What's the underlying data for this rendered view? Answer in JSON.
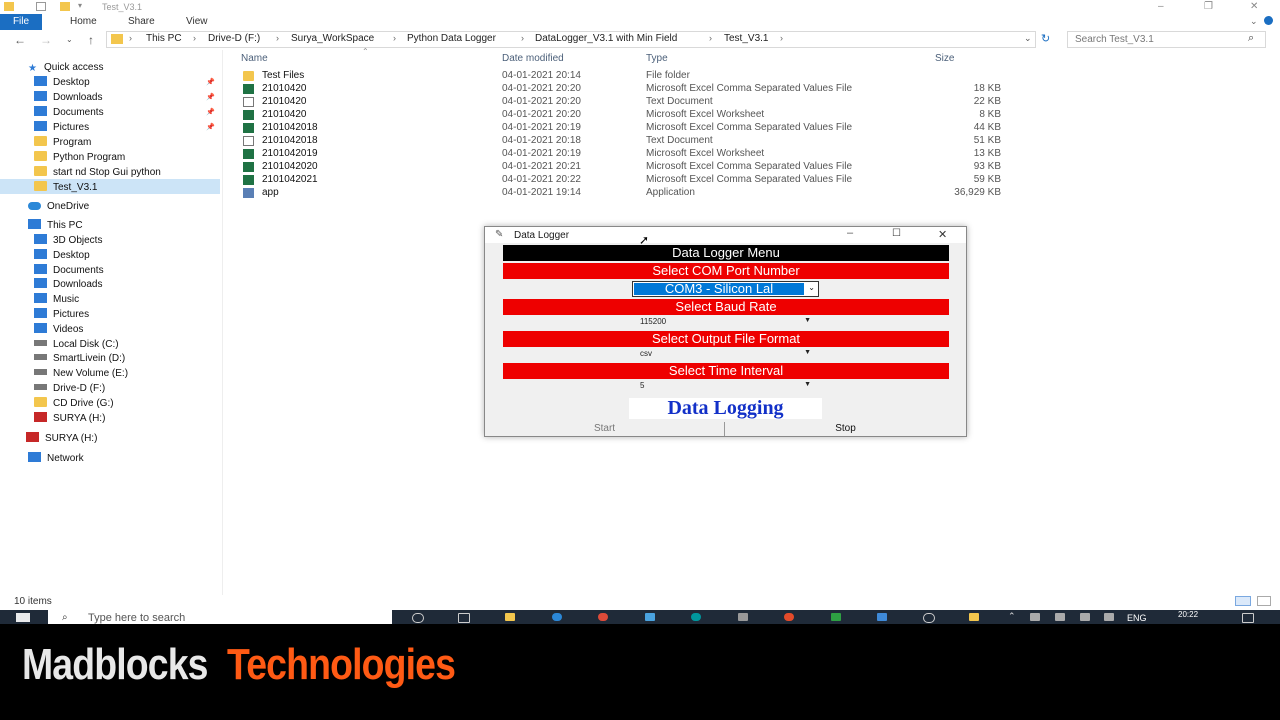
{
  "window": {
    "title": "Test_V3.1"
  },
  "ribbon": {
    "tabs": [
      "File",
      "Home",
      "Share",
      "View"
    ]
  },
  "address": {
    "breadcrumbs": [
      "This PC",
      "Drive-D (F:)",
      "Surya_WorkSpace",
      "Python Data Logger",
      "DataLogger_V3.1 with Min Field",
      "Test_V3.1"
    ],
    "search_placeholder": "Search Test_V3.1"
  },
  "nav_pane": {
    "quick_access": "Quick access",
    "quick_items": [
      "Desktop",
      "Downloads",
      "Documents",
      "Pictures",
      "Program",
      "Python Program",
      "start nd Stop Gui python",
      "Test_V3.1"
    ],
    "onedrive": "OneDrive",
    "this_pc": "This PC",
    "pc_items": [
      "3D Objects",
      "Desktop",
      "Documents",
      "Downloads",
      "Music",
      "Pictures",
      "Videos",
      "Local Disk (C:)",
      "SmartLivein (D:)",
      "New Volume (E:)",
      "Drive-D (F:)",
      "CD Drive (G:)",
      "SURYA (H:)"
    ],
    "surya": "SURYA (H:)",
    "network": "Network"
  },
  "file_list": {
    "headers": [
      "Name",
      "Date modified",
      "Type",
      "Size"
    ],
    "rows": [
      {
        "icon": "folder",
        "name": "Test Files",
        "date": "04-01-2021 20:14",
        "type": "File folder",
        "size": ""
      },
      {
        "icon": "xls",
        "name": "21010420",
        "date": "04-01-2021 20:20",
        "type": "Microsoft Excel Comma Separated Values File",
        "size": "18 KB"
      },
      {
        "icon": "txt",
        "name": "21010420",
        "date": "04-01-2021 20:20",
        "type": "Text Document",
        "size": "22 KB"
      },
      {
        "icon": "xls",
        "name": "21010420",
        "date": "04-01-2021 20:20",
        "type": "Microsoft Excel Worksheet",
        "size": "8 KB"
      },
      {
        "icon": "xls",
        "name": "2101042018",
        "date": "04-01-2021 20:19",
        "type": "Microsoft Excel Comma Separated Values File",
        "size": "44 KB"
      },
      {
        "icon": "txt",
        "name": "2101042018",
        "date": "04-01-2021 20:18",
        "type": "Text Document",
        "size": "51 KB"
      },
      {
        "icon": "xls",
        "name": "2101042019",
        "date": "04-01-2021 20:19",
        "type": "Microsoft Excel Worksheet",
        "size": "13 KB"
      },
      {
        "icon": "xls",
        "name": "2101042020",
        "date": "04-01-2021 20:21",
        "type": "Microsoft Excel Comma Separated Values File",
        "size": "93 KB"
      },
      {
        "icon": "xls",
        "name": "2101042021",
        "date": "04-01-2021 20:22",
        "type": "Microsoft Excel Comma Separated Values File",
        "size": "59 KB"
      },
      {
        "icon": "exe",
        "name": "app",
        "date": "04-01-2021 19:14",
        "type": "Application",
        "size": "36,929 KB"
      }
    ]
  },
  "status": {
    "items": "10 items"
  },
  "dialog": {
    "title": "Data Logger",
    "menu_header": "Data Logger Menu",
    "com_label": "Select COM Port Number",
    "com_value": "COM3 - Silicon Lal",
    "baud_label": "Select Baud Rate",
    "baud_value": "115200",
    "format_label": "Select Output File Format",
    "format_value": "csv",
    "interval_label": "Select Time Interval",
    "interval_value": "5",
    "logging_label": "Data Logging",
    "start_label": "Start",
    "stop_label": "Stop",
    "colors": {
      "header": "#000000",
      "band": "#ee0000",
      "logging_text": "#1230c8"
    }
  },
  "taskbar": {
    "search_placeholder": "Type here to search",
    "lang": "ENG",
    "time": "20:22"
  },
  "footer": {
    "brand_part1": "Madblocks",
    "brand_part2": "Technologies"
  }
}
